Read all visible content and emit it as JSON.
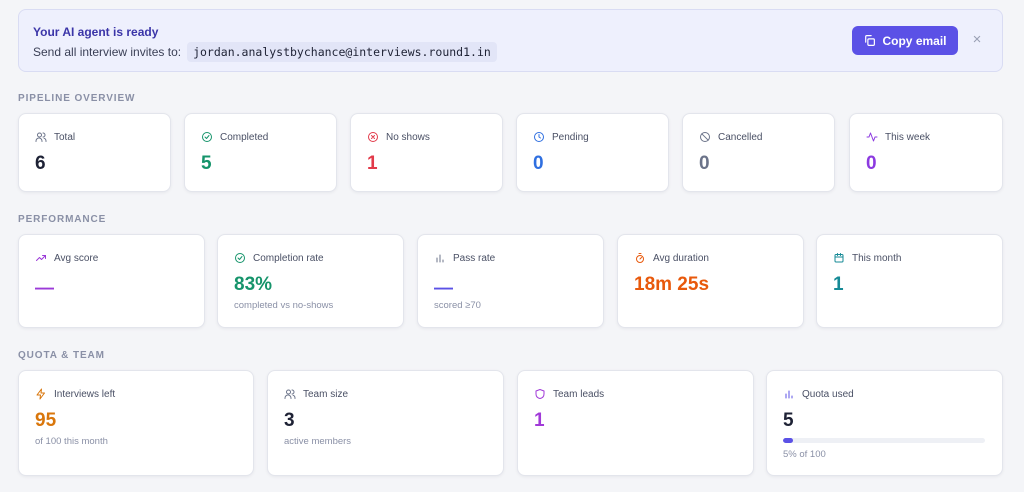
{
  "banner": {
    "title": "Your AI agent is ready",
    "text": "Send all interview invites to:",
    "email": "jordan.analystbychance@interviews.round1.in",
    "copy_label": "Copy email",
    "close_symbol": "×"
  },
  "pipeline": {
    "label": "PIPELINE OVERVIEW",
    "cards": [
      {
        "label": "Total",
        "value": "6",
        "icon": "users-icon",
        "color": "#1e2235"
      },
      {
        "label": "Completed",
        "value": "5",
        "icon": "check-circle-icon",
        "color": "#16946b"
      },
      {
        "label": "No shows",
        "value": "1",
        "icon": "x-circle-icon",
        "color": "#e23a4a"
      },
      {
        "label": "Pending",
        "value": "0",
        "icon": "clock-icon",
        "color": "#2f6fe0"
      },
      {
        "label": "Cancelled",
        "value": "0",
        "icon": "ban-icon",
        "color": "#6b7389"
      },
      {
        "label": "This week",
        "value": "0",
        "icon": "activity-icon",
        "color": "#8c3ae0"
      }
    ]
  },
  "performance": {
    "label": "PERFORMANCE",
    "cards": [
      {
        "label": "Avg score",
        "value": "—",
        "icon": "trend-icon",
        "color": "#9b3ad8",
        "sub": ""
      },
      {
        "label": "Completion rate",
        "value": "83%",
        "icon": "check-circle-icon",
        "color": "#16946b",
        "sub": "completed vs no-shows"
      },
      {
        "label": "Pass rate",
        "value": "—",
        "icon": "bar-chart-icon",
        "color": "#5b51e6",
        "sub": "scored ≥70"
      },
      {
        "label": "Avg duration",
        "value": "18m 25s",
        "icon": "timer-icon",
        "color": "#e8590c",
        "sub": ""
      },
      {
        "label": "This month",
        "value": "1",
        "icon": "calendar-icon",
        "color": "#168a96",
        "sub": ""
      }
    ]
  },
  "quota": {
    "label": "QUOTA & TEAM",
    "cards": [
      {
        "label": "Interviews left",
        "value": "95",
        "icon": "bolt-icon",
        "color": "#d9760b",
        "sub": "of 100 this month"
      },
      {
        "label": "Team size",
        "value": "3",
        "icon": "users-icon",
        "color": "#1e2235",
        "sub": "active members"
      },
      {
        "label": "Team leads",
        "value": "1",
        "icon": "shield-icon",
        "color": "#a13ad8",
        "sub": ""
      },
      {
        "label": "Quota used",
        "value": "5",
        "icon": "bar-chart-icon",
        "color": "#1e2235",
        "sub": "5% of 100",
        "progress": 0.05
      }
    ]
  }
}
